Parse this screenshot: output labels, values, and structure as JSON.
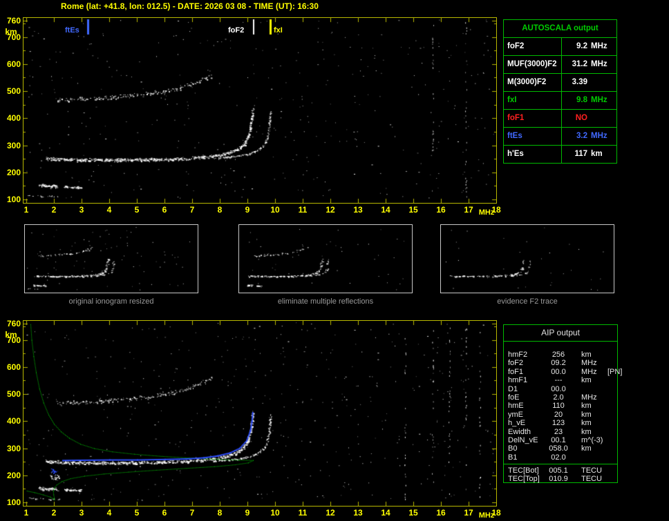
{
  "title": "Rome (lat: +41.8, lon: 012.5) - DATE: 2026 03 08 - TIME (UT): 16:30",
  "colors": {
    "background": "#000000",
    "axis": "#b9b900",
    "axis_text": "#ffff00",
    "table_border": "#00bb00",
    "autoscala_title_green": "#00cc00",
    "value_white": "#ffffff",
    "value_green": "#00cc00",
    "value_red": "#ff2020",
    "value_blue": "#4169ff",
    "profile_green": "#00cc00",
    "scaled_trace_blue": "#2e4fff",
    "caption_gray": "#9a9a9a"
  },
  "autoscala": {
    "title": "AUTOSCALA output",
    "rows": [
      {
        "label": "foF2",
        "value": "9.2",
        "unit": "MHz",
        "color": "#ffffff"
      },
      {
        "label": "MUF(3000)F2",
        "value": "31.2",
        "unit": "MHz",
        "color": "#ffffff"
      },
      {
        "label": "M(3000)F2",
        "value": "3.39",
        "unit": "",
        "color": "#ffffff"
      },
      {
        "label": "fxI",
        "value": "9.8",
        "unit": "MHz",
        "color": "#00cc00"
      },
      {
        "label": "foF1",
        "value": "NO",
        "unit": "",
        "color": "#ff2020"
      },
      {
        "label": "ftEs",
        "value": "3.2",
        "unit": "MHz",
        "color": "#4169ff"
      },
      {
        "label": "h'Es",
        "value": "117",
        "unit": "km",
        "color": "#ffffff"
      }
    ]
  },
  "aip": {
    "title": "AIP output",
    "rows": [
      {
        "label": "hmF2",
        "value": "256",
        "unit": "km",
        "extra": ""
      },
      {
        "label": "foF2",
        "value": "09.2",
        "unit": "MHz",
        "extra": ""
      },
      {
        "label": "foF1",
        "value": "00.0",
        "unit": "MHz",
        "extra": "[PN]"
      },
      {
        "label": "hmF1",
        "value": "---",
        "unit": "km",
        "extra": ""
      },
      {
        "label": "D1",
        "value": "00.0",
        "unit": "",
        "extra": ""
      },
      {
        "label": "foE",
        "value": "2.0",
        "unit": "MHz",
        "extra": ""
      },
      {
        "label": "hmE",
        "value": "110",
        "unit": "km",
        "extra": ""
      },
      {
        "label": "ymE",
        "value": "20",
        "unit": "km",
        "extra": ""
      },
      {
        "label": "h_vE",
        "value": "123",
        "unit": "km",
        "extra": ""
      },
      {
        "label": "Ewidth",
        "value": "23",
        "unit": "km",
        "extra": ""
      },
      {
        "label": "DelN_vE",
        "value": "00.1",
        "unit": "m^(-3)",
        "extra": ""
      },
      {
        "label": "B0",
        "value": "058.0",
        "unit": "km",
        "extra": ""
      },
      {
        "label": "B1",
        "value": "02.0",
        "unit": "",
        "extra": ""
      }
    ],
    "tec_rows": [
      {
        "label": "TEC[Bot]",
        "value": "005.1",
        "unit": "TECU"
      },
      {
        "label": "TEC[Top]",
        "value": "010.9",
        "unit": "TECU"
      }
    ]
  },
  "thumbnails": [
    {
      "caption": "original ionogram resized",
      "traces": [
        "es",
        "es2",
        "es_low",
        "f_ord",
        "f_x",
        "hop2"
      ],
      "density": 0.55,
      "noise_count": 80,
      "seed": 101
    },
    {
      "caption": "eliminate multiple reflections",
      "traces": [
        "es",
        "es2",
        "f_ord",
        "f_x",
        "hop2"
      ],
      "density": 0.5,
      "noise_count": 45,
      "seed": 202
    },
    {
      "caption": "evidence F2 trace",
      "traces": [
        "f_ord",
        "f_x"
      ],
      "density": 0.35,
      "noise_count": 30,
      "seed": 303
    }
  ],
  "chart_data": [
    {
      "id": "top_ionogram",
      "type": "scatter",
      "title": "measured ionogram with autoscaled characteristics",
      "xlabel": "MHz",
      "ylabel": "km",
      "xlim": [
        1,
        18
      ],
      "ylim": [
        100,
        760
      ],
      "x_ticks": [
        1,
        2,
        3,
        4,
        5,
        6,
        7,
        8,
        9,
        10,
        11,
        12,
        13,
        14,
        15,
        16,
        17,
        18
      ],
      "y_ticks": [
        760,
        700,
        600,
        500,
        400,
        300,
        200,
        100
      ],
      "grid": false,
      "legend": "none",
      "markers": [
        {
          "id": "ftEs",
          "label": "ftEs",
          "f": 3.2,
          "color": "#4169ff",
          "label_dx": -32
        },
        {
          "id": "foF2",
          "label": "foF2",
          "f": 9.2,
          "color": "#ffffff",
          "label_dx": -36
        },
        {
          "id": "fxI",
          "label": "fxI",
          "f": 9.8,
          "color": "#ffff00",
          "label_dx": 6
        }
      ],
      "traces": [
        "es_low",
        "es",
        "es2",
        "f_ord",
        "f_x",
        "hop2"
      ],
      "noise": {
        "count": 380,
        "seed": 11,
        "columns": [
          15.7,
          16.9
        ],
        "col_count": 26
      }
    },
    {
      "id": "bottom_ionogram",
      "type": "scatter",
      "title": "ionogram with restored electron density profile and scaled F2 trace",
      "xlabel": "MHz",
      "ylabel": "km",
      "xlim": [
        1,
        18
      ],
      "ylim": [
        100,
        760
      ],
      "x_ticks": [
        1,
        2,
        3,
        4,
        5,
        6,
        7,
        8,
        9,
        10,
        11,
        12,
        13,
        14,
        15,
        16,
        17,
        18
      ],
      "y_ticks": [
        760,
        700,
        600,
        500,
        400,
        300,
        200,
        100
      ],
      "grid": false,
      "legend": "none",
      "markers": [],
      "traces": [
        "es_low",
        "es",
        "es2",
        "f_ord",
        "f_x",
        "hop2",
        "f_blob",
        "profile",
        "profile_e",
        "scaled_blob",
        "scaled_f2"
      ],
      "noise": {
        "count": 460,
        "seed": 29,
        "columns": [
          14.7,
          15.7,
          16.3,
          16.9,
          17.4
        ],
        "col_count": 22
      }
    }
  ],
  "ionogram_traces": {
    "es_low": {
      "color": "#ffffff",
      "density": 0.35,
      "spread": 3,
      "dash": 2,
      "points": [
        [
          1.05,
          116
        ],
        [
          1.6,
          113
        ],
        [
          2.2,
          112
        ]
      ]
    },
    "es": {
      "color": "#ffffff",
      "density": 2.0,
      "spread": 5,
      "dash": 3,
      "points": [
        [
          1.45,
          153
        ],
        [
          1.8,
          150
        ],
        [
          2.1,
          149
        ]
      ]
    },
    "es2": {
      "color": "#ffffff",
      "density": 1.8,
      "spread": 4,
      "dash": 3,
      "points": [
        [
          2.35,
          148
        ],
        [
          2.65,
          146
        ],
        [
          2.95,
          145
        ]
      ]
    },
    "f_ord": {
      "color": "#ffffff",
      "density": 1.7,
      "spread": 5,
      "dash": 3,
      "points": [
        [
          1.7,
          252
        ],
        [
          2.2,
          249
        ],
        [
          3.0,
          247
        ],
        [
          4.0,
          246
        ],
        [
          5.0,
          247
        ],
        [
          6.0,
          249
        ],
        [
          6.8,
          252
        ],
        [
          7.4,
          257
        ],
        [
          7.9,
          263
        ],
        [
          8.3,
          272
        ],
        [
          8.6,
          284
        ],
        [
          8.85,
          302
        ],
        [
          9.0,
          328
        ],
        [
          9.1,
          362
        ],
        [
          9.15,
          400
        ],
        [
          9.18,
          435
        ]
      ]
    },
    "f_x": {
      "color": "#ffffff",
      "density": 1.1,
      "spread": 3,
      "dash": 2,
      "points": [
        [
          7.7,
          253
        ],
        [
          8.3,
          257
        ],
        [
          8.8,
          263
        ],
        [
          9.15,
          272
        ],
        [
          9.4,
          284
        ],
        [
          9.6,
          300
        ],
        [
          9.7,
          322
        ],
        [
          9.76,
          352
        ],
        [
          9.8,
          392
        ],
        [
          9.83,
          428
        ]
      ]
    },
    "hop2": {
      "color": "#ffffff",
      "density": 0.85,
      "spread": 7,
      "dash": 2,
      "points": [
        [
          2.1,
          468
        ],
        [
          2.7,
          470
        ],
        [
          3.3,
          473
        ],
        [
          3.9,
          476
        ],
        [
          4.5,
          481
        ],
        [
          5.1,
          487
        ],
        [
          5.7,
          495
        ],
        [
          6.2,
          505
        ],
        [
          6.7,
          517
        ],
        [
          7.1,
          531
        ],
        [
          7.5,
          548
        ],
        [
          7.7,
          560
        ]
      ]
    },
    "f_blob": {
      "color": "#ffffff",
      "density": 1.6,
      "spread": 10,
      "dash": 2,
      "points": [
        [
          1.85,
          198
        ],
        [
          2.05,
          192
        ],
        [
          2.2,
          188
        ]
      ]
    },
    "profile": {
      "color": "#00cc00",
      "style": "line",
      "size": 1,
      "points": [
        [
          1.15,
          758
        ],
        [
          1.19,
          700
        ],
        [
          1.26,
          640
        ],
        [
          1.35,
          580
        ],
        [
          1.47,
          520
        ],
        [
          1.62,
          468
        ],
        [
          1.8,
          424
        ],
        [
          2.0,
          390
        ],
        [
          2.25,
          362
        ],
        [
          2.55,
          338
        ],
        [
          2.95,
          316
        ],
        [
          3.45,
          300
        ],
        [
          4.1,
          288
        ],
        [
          4.9,
          279
        ],
        [
          5.9,
          271
        ],
        [
          6.9,
          265
        ],
        [
          7.9,
          260
        ],
        [
          8.7,
          257
        ],
        [
          9.2,
          256
        ],
        [
          9.02,
          247
        ],
        [
          8.55,
          240
        ],
        [
          7.8,
          233
        ],
        [
          6.8,
          227
        ],
        [
          5.7,
          220
        ],
        [
          4.7,
          213
        ],
        [
          3.8,
          206
        ],
        [
          3.1,
          198
        ],
        [
          2.6,
          189
        ],
        [
          2.28,
          178
        ],
        [
          2.1,
          166
        ],
        [
          2.0,
          154
        ],
        [
          1.97,
          141
        ],
        [
          1.98,
          129
        ],
        [
          2.0,
          118
        ],
        [
          2.0,
          110
        ]
      ]
    },
    "profile_e": {
      "color": "#00cc00",
      "style": "line",
      "size": 1,
      "points": [
        [
          1.02,
          143
        ],
        [
          1.3,
          137
        ],
        [
          1.6,
          129
        ],
        [
          1.85,
          121
        ],
        [
          1.97,
          114
        ]
      ]
    },
    "scaled_blob": {
      "color": "#2e4fff",
      "density": 2.2,
      "spread": 8,
      "dash": 2,
      "points": [
        [
          1.9,
          222
        ],
        [
          2.0,
          215
        ],
        [
          2.1,
          208
        ]
      ]
    },
    "scaled_f2": {
      "color": "#2e4fff",
      "style": "line",
      "size": 2,
      "points": [
        [
          2.3,
          257
        ],
        [
          3.0,
          258
        ],
        [
          4.0,
          259
        ],
        [
          5.0,
          259
        ],
        [
          6.0,
          261
        ],
        [
          6.8,
          263
        ],
        [
          7.4,
          267
        ],
        [
          7.9,
          274
        ],
        [
          8.35,
          285
        ],
        [
          8.7,
          302
        ],
        [
          8.95,
          330
        ],
        [
          9.08,
          365
        ],
        [
          9.14,
          400
        ],
        [
          9.17,
          434
        ]
      ]
    }
  }
}
